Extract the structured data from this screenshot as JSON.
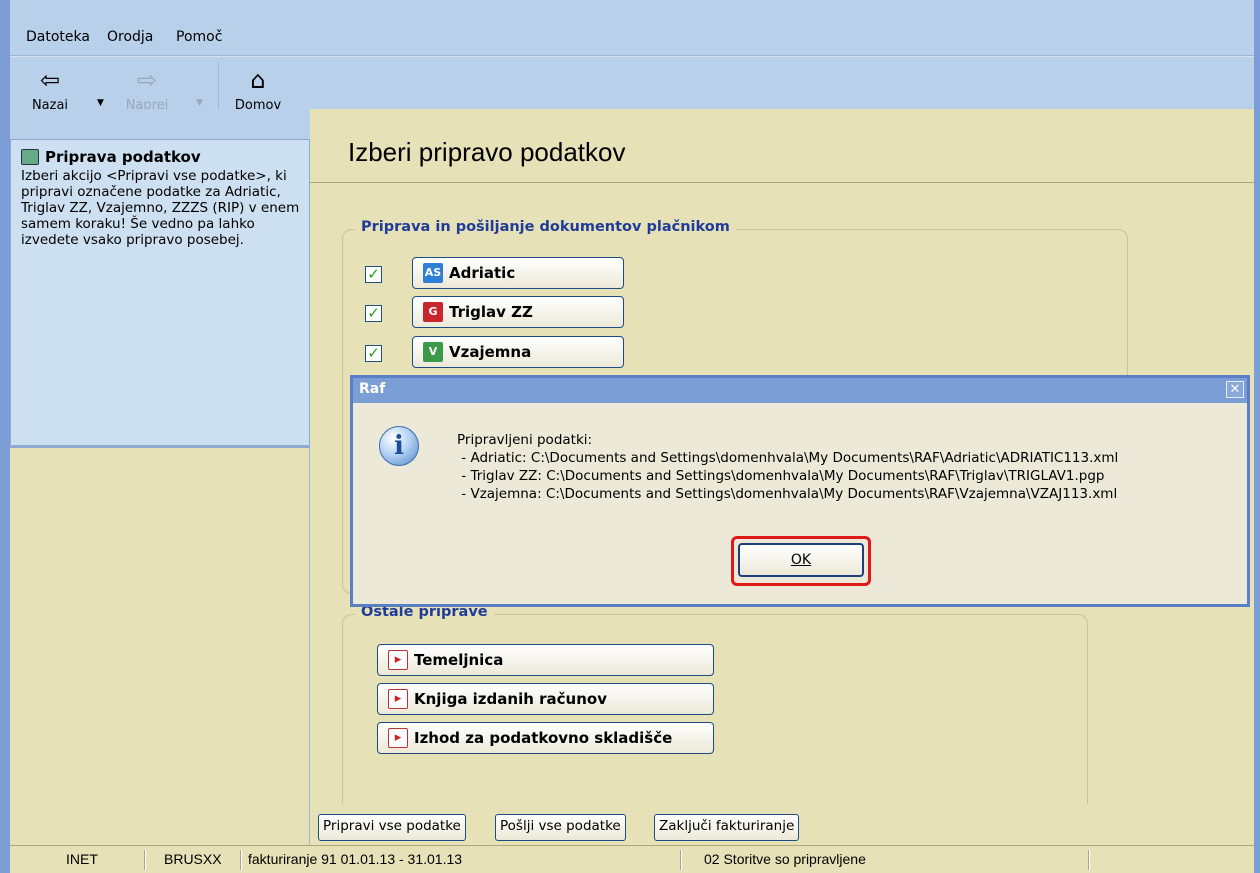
{
  "menu": {
    "items": [
      "Datoteka",
      "Orodja",
      "Pomoč"
    ]
  },
  "toolbar": {
    "back_label": "Nazaj",
    "forward_label": "Naprej",
    "home_label": "Domov"
  },
  "help": {
    "title": "Priprava podatkov",
    "text": "Izberi akcijo <Pripravi vse podatke>, ki pripravi označene podatke za Adriatic, Triglav ZZ, Vzajemno, ZZZS (RIP) v enem samem koraku! Še vedno pa lahko izvedete vsako pripravo posebej."
  },
  "main": {
    "title": "Izberi pripravo podatkov",
    "group1": {
      "title": "Priprava in pošiljanje dokumentov plačnikom",
      "items": [
        {
          "label": "Adriatic",
          "checked": true,
          "logo": "AS"
        },
        {
          "label": "Triglav ZZ",
          "checked": true,
          "logo": "G"
        },
        {
          "label": "Vzajemna",
          "checked": true,
          "logo": "V"
        }
      ]
    },
    "group2": {
      "title": "Ostale priprave",
      "items": [
        {
          "label": "Temeljnica"
        },
        {
          "label": "Knjiga izdanih računov"
        },
        {
          "label": "Izhod za podatkovno skladišče"
        }
      ]
    },
    "bottom_buttons": [
      "Pripravi vse podatke",
      "Pošlji vse podatke",
      "Zaključi fakturiranje"
    ]
  },
  "dialog": {
    "title": "Raf",
    "message": "Pripravljeni podatki:\n - Adriatic: C:\\Documents and Settings\\domenhvala\\My Documents\\RAF\\Adriatic\\ADRIATIC113.xml\n - Triglav ZZ: C:\\Documents and Settings\\domenhvala\\My Documents\\RAF\\Triglav\\TRIGLAV1.pgp\n - Vzajemna: C:\\Documents and Settings\\domenhvala\\My Documents\\RAF\\Vzajemna\\VZAJ113.xml",
    "ok_label": "OK"
  },
  "status": {
    "cells": [
      "INET",
      "BRUSXX",
      "fakturiranje 91  01.01.13 - 31.01.13",
      "02 Storitve so pripravljene"
    ]
  },
  "colors": {
    "frame": "#7c9ed6",
    "menubar": "#b8d0ea",
    "pane": "#e6e1b6",
    "group_title": "#1f3c9a",
    "highlight": "#e01818"
  }
}
